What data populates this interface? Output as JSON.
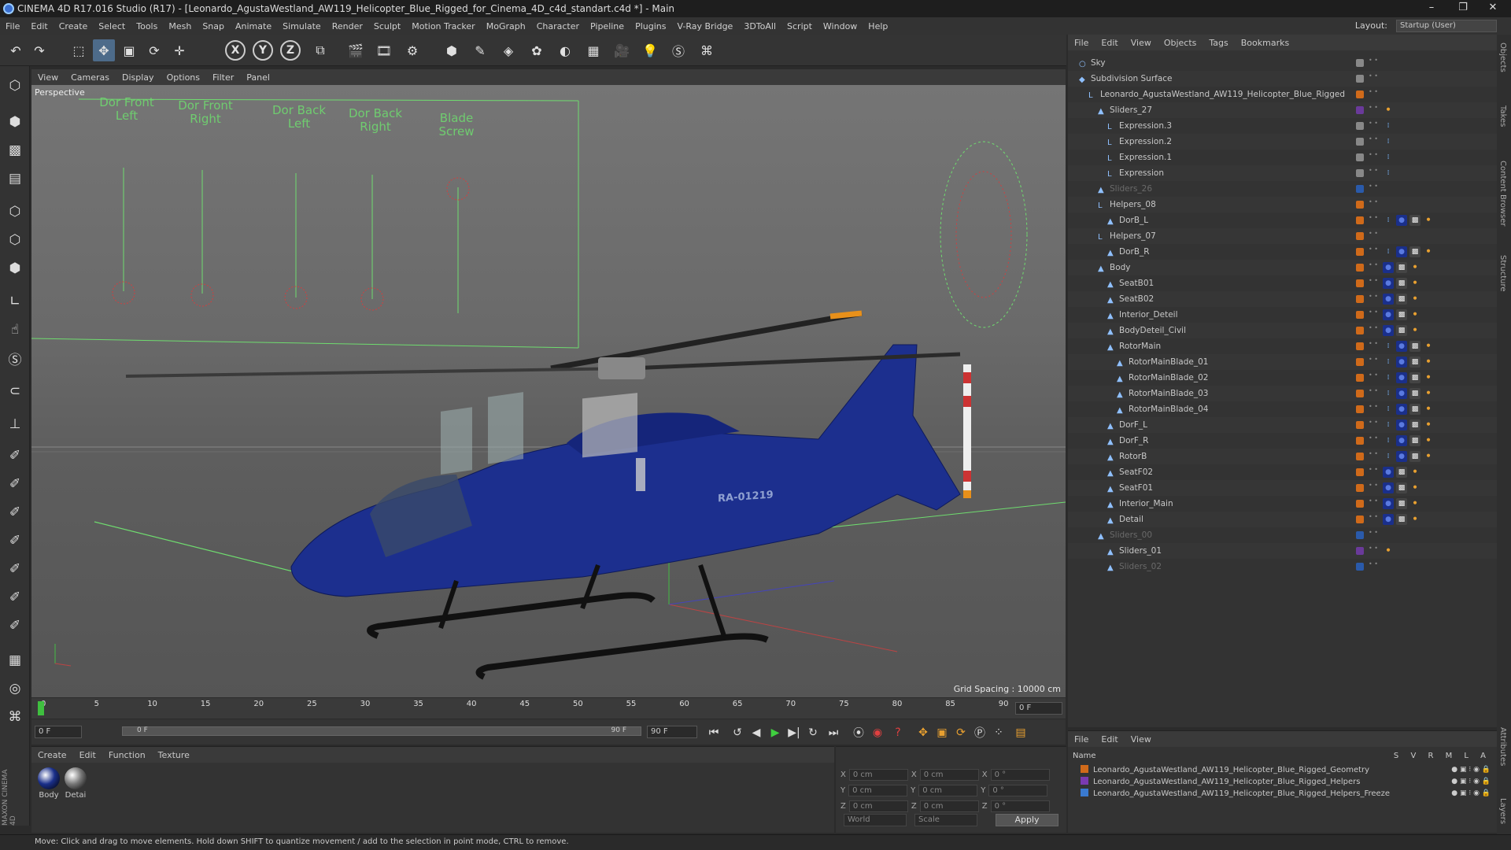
{
  "window": {
    "title": "CINEMA 4D R17.016 Studio (R17) - [Leonardo_AgustaWestland_AW119_Helicopter_Blue_Rigged_for_Cinema_4D_c4d_standart.c4d *] - Main",
    "minimize": "–",
    "restore": "❐",
    "close": "✕"
  },
  "menubar": {
    "items": [
      "File",
      "Edit",
      "Create",
      "Select",
      "Tools",
      "Mesh",
      "Snap",
      "Animate",
      "Simulate",
      "Render",
      "Sculpt",
      "Motion Tracker",
      "MoGraph",
      "Character",
      "Pipeline",
      "Plugins",
      "V-Ray Bridge",
      "3DToAll",
      "Script",
      "Window",
      "Help"
    ],
    "layout_label": "Layout:",
    "layout_value": "Startup (User)"
  },
  "viewport": {
    "menu": [
      "View",
      "Cameras",
      "Display",
      "Options",
      "Filter",
      "Panel"
    ],
    "label": "Perspective",
    "grid_spacing": "Grid Spacing : 10000 cm",
    "sliders": [
      "Dor Front Left",
      "Dor Front Right",
      "Dor Back Left",
      "Dor Back Right",
      "Blade Screw"
    ],
    "registration": "RA-01219"
  },
  "timeline": {
    "ticks": [
      "0",
      "5",
      "10",
      "15",
      "20",
      "25",
      "30",
      "35",
      "40",
      "45",
      "50",
      "55",
      "60",
      "65",
      "70",
      "75",
      "80",
      "85",
      "90"
    ],
    "current_frame": "0 F"
  },
  "playback": {
    "start": "0 F",
    "range_start": "0 F",
    "range_end": "90 F",
    "end": "90 F"
  },
  "material_manager": {
    "menu": [
      "Create",
      "Edit",
      "Function",
      "Texture"
    ],
    "materials": [
      {
        "name": "Body",
        "color": "#1a2f8a"
      },
      {
        "name": "Detai",
        "color": "#777777"
      }
    ]
  },
  "coordinates": {
    "rows": [
      {
        "a": "X",
        "v1": "0 cm",
        "b": "X",
        "v2": "0 cm",
        "c": "X",
        "v3": "0 °"
      },
      {
        "a": "Y",
        "v1": "0 cm",
        "b": "Y",
        "v2": "0 cm",
        "c": "Y",
        "v3": "0 °"
      },
      {
        "a": "Z",
        "v1": "0 cm",
        "b": "Z",
        "v2": "0 cm",
        "c": "Z",
        "v3": "0 °"
      }
    ],
    "space": "World",
    "mode": "Scale",
    "apply": "Apply"
  },
  "status": "Move: Click and drag to move elements. Hold down SHIFT to quantize movement / add to the selection in point mode, CTRL to remove.",
  "object_manager": {
    "menu": [
      "File",
      "Edit",
      "View",
      "Objects",
      "Tags",
      "Bookmarks"
    ],
    "objects": [
      {
        "name": "Sky",
        "indent": 0,
        "icon": "○",
        "vis": "#888",
        "tags": ""
      },
      {
        "name": "Subdivision Surface",
        "indent": 0,
        "icon": "◆",
        "vis": "#888",
        "tags": ""
      },
      {
        "name": "Leonardo_AgustaWestland_AW119_Helicopter_Blue_Rigged",
        "indent": 1,
        "icon": "L",
        "vis": "#d06a1a",
        "tags": ""
      },
      {
        "name": "Sliders_27",
        "indent": 2,
        "icon": "▲",
        "vis": "#6a3a9a",
        "tags": "o"
      },
      {
        "name": "Expression.3",
        "indent": 3,
        "icon": "L",
        "vis": "#888",
        "tags": "x"
      },
      {
        "name": "Expression.2",
        "indent": 3,
        "icon": "L",
        "vis": "#888",
        "tags": "x"
      },
      {
        "name": "Expression.1",
        "indent": 3,
        "icon": "L",
        "vis": "#888",
        "tags": "x"
      },
      {
        "name": "Expression",
        "indent": 3,
        "icon": "L",
        "vis": "#888",
        "tags": "x"
      },
      {
        "name": "Sliders_26",
        "indent": 2,
        "icon": "▲",
        "vis": "#2a5aaa",
        "tags": "",
        "dim": true
      },
      {
        "name": "Helpers_08",
        "indent": 2,
        "icon": "L",
        "vis": "#d06a1a",
        "tags": ""
      },
      {
        "name": "DorB_L",
        "indent": 3,
        "icon": "▲",
        "vis": "#d06a1a",
        "tags": "xbco"
      },
      {
        "name": "Helpers_07",
        "indent": 2,
        "icon": "L",
        "vis": "#d06a1a",
        "tags": ""
      },
      {
        "name": "DorB_R",
        "indent": 3,
        "icon": "▲",
        "vis": "#d06a1a",
        "tags": "xbco"
      },
      {
        "name": "Body",
        "indent": 2,
        "icon": "▲",
        "vis": "#d06a1a",
        "tags": "bco"
      },
      {
        "name": "SeatB01",
        "indent": 3,
        "icon": "▲",
        "vis": "#d06a1a",
        "tags": "bco"
      },
      {
        "name": "SeatB02",
        "indent": 3,
        "icon": "▲",
        "vis": "#d06a1a",
        "tags": "bco"
      },
      {
        "name": "Interior_Deteil",
        "indent": 3,
        "icon": "▲",
        "vis": "#d06a1a",
        "tags": "bco"
      },
      {
        "name": "BodyDeteil_Civil",
        "indent": 3,
        "icon": "▲",
        "vis": "#d06a1a",
        "tags": "bco"
      },
      {
        "name": "RotorMain",
        "indent": 3,
        "icon": "▲",
        "vis": "#d06a1a",
        "tags": "xbco"
      },
      {
        "name": "RotorMainBlade_01",
        "indent": 4,
        "icon": "▲",
        "vis": "#d06a1a",
        "tags": "xbco"
      },
      {
        "name": "RotorMainBlade_02",
        "indent": 4,
        "icon": "▲",
        "vis": "#d06a1a",
        "tags": "xbco"
      },
      {
        "name": "RotorMainBlade_03",
        "indent": 4,
        "icon": "▲",
        "vis": "#d06a1a",
        "tags": "xbco"
      },
      {
        "name": "RotorMainBlade_04",
        "indent": 4,
        "icon": "▲",
        "vis": "#d06a1a",
        "tags": "xbco"
      },
      {
        "name": "DorF_L",
        "indent": 3,
        "icon": "▲",
        "vis": "#d06a1a",
        "tags": "xbco"
      },
      {
        "name": "DorF_R",
        "indent": 3,
        "icon": "▲",
        "vis": "#d06a1a",
        "tags": "xbco"
      },
      {
        "name": "RotorB",
        "indent": 3,
        "icon": "▲",
        "vis": "#d06a1a",
        "tags": "xbco"
      },
      {
        "name": "SeatF02",
        "indent": 3,
        "icon": "▲",
        "vis": "#d06a1a",
        "tags": "bco"
      },
      {
        "name": "SeatF01",
        "indent": 3,
        "icon": "▲",
        "vis": "#d06a1a",
        "tags": "bco"
      },
      {
        "name": "Interior_Main",
        "indent": 3,
        "icon": "▲",
        "vis": "#d06a1a",
        "tags": "bco"
      },
      {
        "name": "Detail",
        "indent": 3,
        "icon": "▲",
        "vis": "#d06a1a",
        "tags": "bco"
      },
      {
        "name": "Sliders_00",
        "indent": 2,
        "icon": "▲",
        "vis": "#2a5aaa",
        "tags": "",
        "dim": true
      },
      {
        "name": "Sliders_01",
        "indent": 3,
        "icon": "▲",
        "vis": "#6a3a9a",
        "tags": "o"
      },
      {
        "name": "Sliders_02",
        "indent": 3,
        "icon": "▲",
        "vis": "#2a5aaa",
        "tags": "",
        "dim": true
      }
    ]
  },
  "layer_manager": {
    "menu": [
      "File",
      "Edit",
      "View"
    ],
    "name_header": "Name",
    "cols": "S V R M L A",
    "layers": [
      {
        "name": "Leonardo_AgustaWestland_AW119_Helicopter_Blue_Rigged_Geometry",
        "color": "#d06a1a"
      },
      {
        "name": "Leonardo_AgustaWestland_AW119_Helicopter_Blue_Rigged_Helpers",
        "color": "#7a3ab0"
      },
      {
        "name": "Leonardo_AgustaWestland_AW119_Helicopter_Blue_Rigged_Helpers_Freeze",
        "color": "#3a7ad0"
      }
    ]
  },
  "side_tabs": [
    "Objects",
    "Takes",
    "Content Browser",
    "Structure",
    "Attributes",
    "Layers"
  ]
}
